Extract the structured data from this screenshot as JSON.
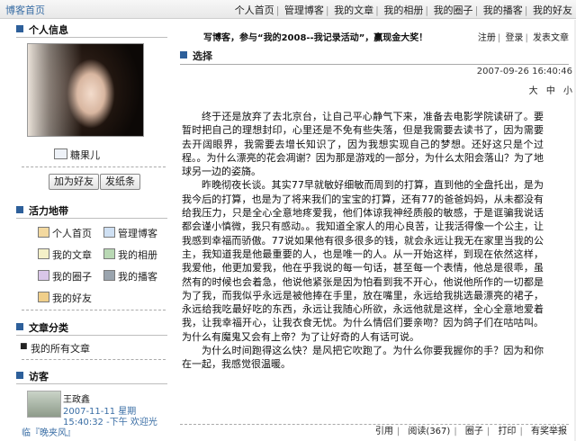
{
  "topbar": {
    "home": "博客首页",
    "nav": [
      "个人首页",
      "管理博客",
      "我的文章",
      "我的相册",
      "我的圈子",
      "我的播客",
      "我的好友"
    ]
  },
  "profile": {
    "heading": "个人信息",
    "nickname": "糖果儿",
    "add_friend": "加为好友",
    "send_note": "发纸条"
  },
  "activity": {
    "heading": "活力地带",
    "items": [
      "个人首页",
      "管理博客",
      "我的文章",
      "我的相册",
      "我的圈子",
      "我的播客",
      "我的好友"
    ]
  },
  "categories": {
    "heading": "文章分类",
    "items": [
      "我的所有文章"
    ]
  },
  "visitors": {
    "heading": "访客",
    "name": "王政鑫",
    "date": "2007-11-11 星期",
    "time": "15:40:32 -下午 欢迎光",
    "extra": "临『晚夹风』"
  },
  "header": {
    "promo": "写博客，参与“我的2008--我记录活动”，赢现金大奖！",
    "links": [
      "注册",
      "登录",
      "发表文章"
    ]
  },
  "post": {
    "title": "选择",
    "time": "2007-09-26 16:40:46",
    "size_controls": "大 中 小",
    "paragraphs": [
      "终于还是放弃了去北京台，让自己平心静气下来，准备去电影学院读研了。要暂时把自己的理想封印，心里还是不免有些失落，但是我需要去读书了，因为需要去开阔眼界，我需要去增长知识了，因为我想实现自己的梦想。还好这只是个过程。。为什么漂亮的花会凋谢？因为那是游戏的一部分，为什么太阳会落山？为了地球另一边的姿旖。",
      "昨晚彻夜长谈。其实77早就敏好细敏而周到的打算，直到他的全盘托出，是为我今后的打算，也是为了将来我们的宝宝的打算，还有77的爸爸妈妈，从未都没有给我压力，只是全心全意地疼爱我，他们体谅我神经质般的敏感，于是诓骗我说话都会谨小慎微，我只有感动。。我知道全家人的用心良苦，让我活得像一个公主，让我感到幸福而骄傲。77说如果他有很多很多的钱，就会永远让我无在家里当我的公主，我知道我是他最重要的人，也是唯一的人。从一开始这样，到现在依然这样，我爱他，他更加爱我，他在乎我说的每一句话，甚至每一个表情，他总是很乖，虽然有的时候也会着急，他说他紧张是因为怕看到我不开心，他说他所作的一切都是为了我，而我似乎永远是被他捧在手里，放在嘴里，永远给我挑选最漂亮的裙子，永远给我吃最好吃的东西，永远让我随心所欲，永远他就是这样，全心全意地爱着我，让我幸福开心，让我衣食无忧。为什么情侣们要亲吻？因为鸽子们在咕咕叫。为什么有魔鬼又会有上帝？为了让好奇的人有话可说。",
      "为什么时间跑得这么快？是风把它吹跑了。为什么你要我握你的手？因为和你在一起，我感觉很温暖。"
    ],
    "actions": [
      "引用",
      "阅读(367)",
      "圈子",
      "打印",
      "有奖举报"
    ]
  },
  "colors": {
    "accent": "#2d5f9a",
    "link": "#3a6ea5"
  },
  "icons": [
    "user-card-icon",
    "house-icon",
    "manage-icon",
    "article-icon",
    "album-icon",
    "circle-icon",
    "podcast-icon",
    "friends-icon"
  ]
}
